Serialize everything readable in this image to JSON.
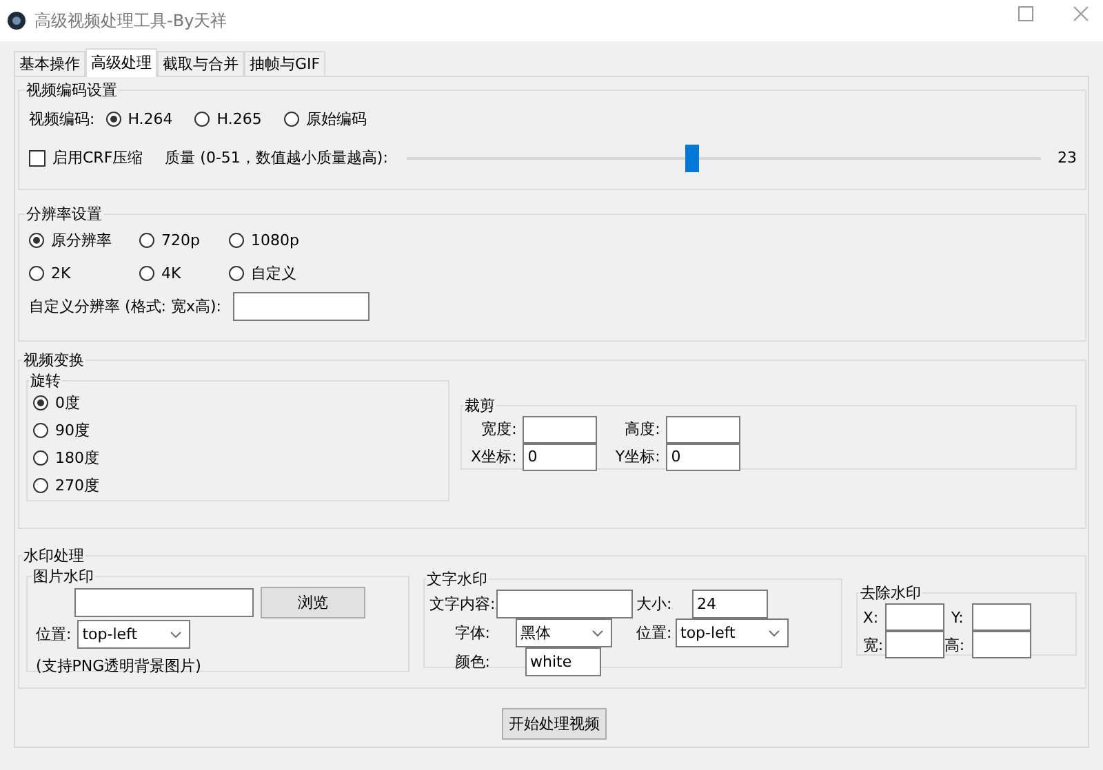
{
  "window": {
    "title": "高级视频处理工具-By天祥"
  },
  "tabs": [
    {
      "label": "基本操作",
      "selected": false
    },
    {
      "label": "高级处理",
      "selected": true
    },
    {
      "label": "截取与合并",
      "selected": false
    },
    {
      "label": "抽帧与GIF",
      "selected": false
    }
  ],
  "encoding": {
    "title": "视频编码设置",
    "codec_label": "视频编码:",
    "codecs": [
      {
        "label": "H.264",
        "selected": true
      },
      {
        "label": "H.265",
        "selected": false
      },
      {
        "label": "原始编码",
        "selected": false
      }
    ],
    "crf": {
      "label": "启用CRF压缩",
      "checked": false
    },
    "quality": {
      "label": "质量 (0-51，数值越小质量越高):",
      "level": 0.45,
      "reading": "23"
    }
  },
  "resolution": {
    "title": "分辨率设置",
    "options": [
      {
        "label": "原分辨率",
        "selected": true
      },
      {
        "label": "720p",
        "selected": false
      },
      {
        "label": "1080p",
        "selected": false
      },
      {
        "label": "2K",
        "selected": false
      },
      {
        "label": "4K",
        "selected": false
      },
      {
        "label": "自定义",
        "selected": false
      }
    ],
    "custom_label": "自定义分辨率 (格式: 宽x高):"
  },
  "transform": {
    "title": "视频变换",
    "rotation": {
      "title": "旋转",
      "options": [
        {
          "label": "0度",
          "selected": true
        },
        {
          "label": "90度",
          "selected": false
        },
        {
          "label": "180度",
          "selected": false
        },
        {
          "label": "270度",
          "selected": false
        }
      ]
    },
    "crop": {
      "title": "裁剪",
      "fields": [
        {
          "label": "宽度:"
        },
        {
          "label": "高度:"
        },
        {
          "label": "X坐标:",
          "value": "0"
        },
        {
          "label": "Y坐标:",
          "value": "0"
        }
      ]
    }
  },
  "watermark": {
    "title": "水印处理",
    "image": {
      "title": "图片水印",
      "browse": "浏览",
      "position_label": "位置:",
      "position": "top-left",
      "note": "(支持PNG透明背景图片)"
    },
    "text": {
      "title": "文字水印",
      "content_label": "文字内容:",
      "size_label": "大小:",
      "size": "24",
      "font_label": "字体:",
      "font": "黑体",
      "position_label": "位置:",
      "position": "top-left",
      "color_label": "颜色:",
      "color_value": "white"
    },
    "remove": {
      "title": "去除水印",
      "fields": [
        {
          "label": "X:"
        },
        {
          "label": "Y:"
        },
        {
          "label": "宽:"
        },
        {
          "label": "高:"
        }
      ]
    }
  },
  "start_button": "开始处理视频"
}
